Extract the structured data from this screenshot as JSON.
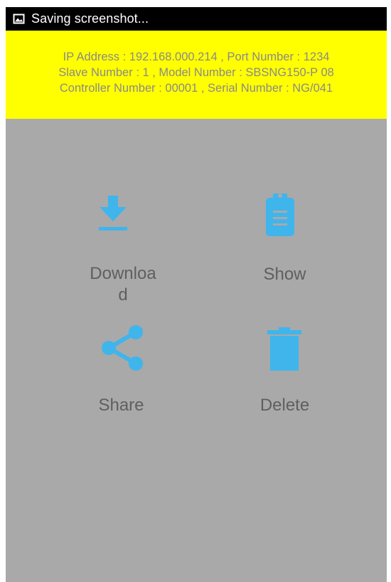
{
  "status_bar": {
    "icon": "image-icon",
    "text": "Saving screenshot..."
  },
  "device_info": {
    "line1": "IP Address : 192.168.000.214 , Port Number : 1234",
    "line2": "Slave Number : 1 , Model Number :   SBSNG150-P 08",
    "line3": "Controller Number : 00001 , Serial Number : NG/041",
    "background_color": "#ffff00",
    "text_color": "#8a8a8a"
  },
  "actions": {
    "download": {
      "label_line1": "Downloa",
      "label_line2": "d",
      "icon": "download-icon"
    },
    "show": {
      "label": "Show",
      "icon": "clipboard-icon"
    },
    "share": {
      "label": "Share",
      "icon": "share-icon"
    },
    "delete": {
      "label": "Delete",
      "icon": "trash-icon"
    }
  },
  "colors": {
    "accent": "#3fb5ec",
    "background": "#a9a9a9",
    "label": "#5f5f5f"
  }
}
